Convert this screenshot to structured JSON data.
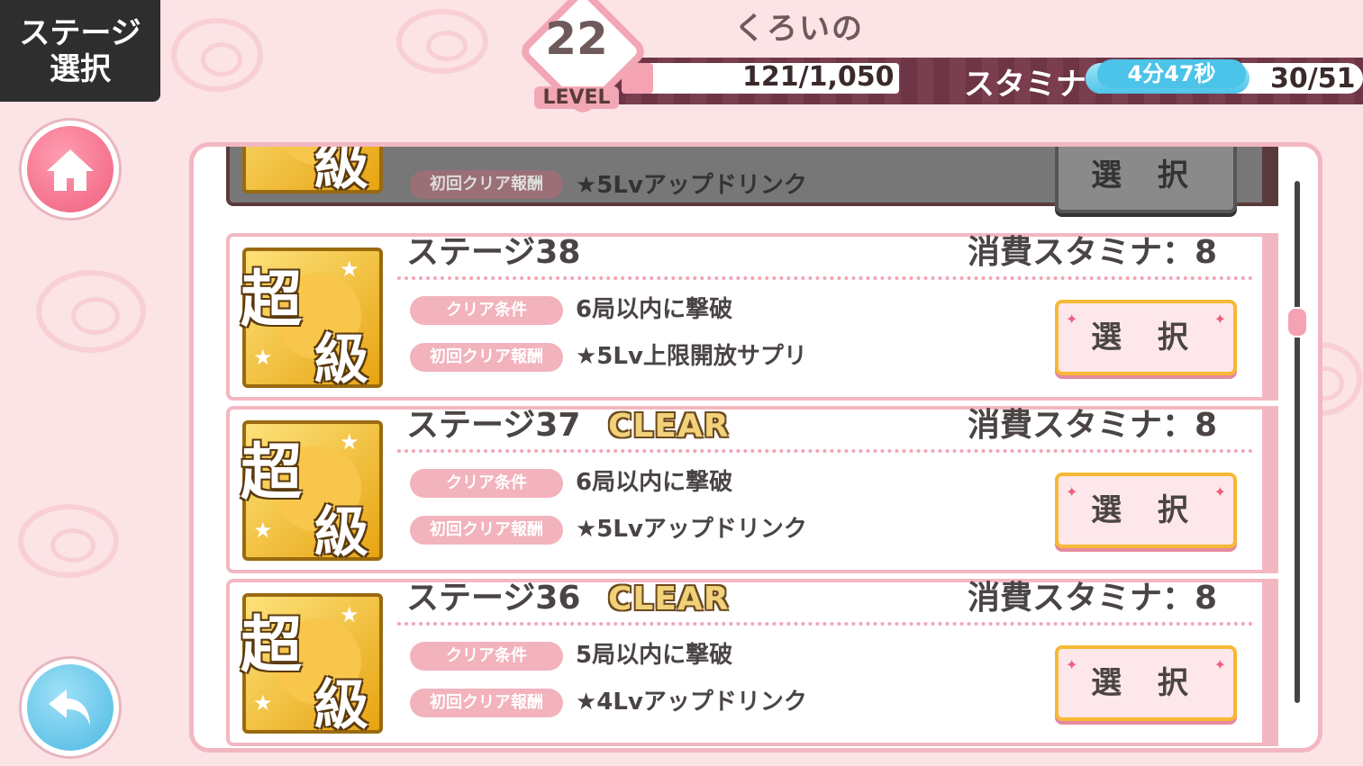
{
  "nav": {
    "stage_select_label_1": "ステージ",
    "stage_select_label_2": "選択"
  },
  "player": {
    "name": "くろいの",
    "level": "22",
    "level_label": "LEVEL",
    "exp_text": "121/1,050",
    "exp_fraction": 0.115
  },
  "stamina": {
    "label": "スタミナ",
    "timer": "4分47秒",
    "value": "30/51",
    "fraction": 0.59
  },
  "icons": {
    "home": "home-icon",
    "back": "back-arrow-icon"
  },
  "difficulty": {
    "kanji_1": "超",
    "kanji_2": "級"
  },
  "labels": {
    "clear_condition": "クリア条件",
    "first_clear_reward": "初回クリア報酬",
    "select": "選 択",
    "clear": "CLEAR"
  },
  "stages": [
    {
      "title": "",
      "cost": "",
      "condition": "",
      "reward": "★5Lvアップドリンク",
      "clear": "",
      "disabled": true
    },
    {
      "title": "ステージ38",
      "cost": "消費スタミナ：8",
      "condition": "6局以内に撃破",
      "reward": "★5Lv上限開放サプリ",
      "clear": "",
      "disabled": false
    },
    {
      "title": "ステージ37",
      "cost": "消費スタミナ：8",
      "condition": "6局以内に撃破",
      "reward": "★5Lvアップドリンク",
      "clear": "CLEAR",
      "disabled": false
    },
    {
      "title": "ステージ36",
      "cost": "消費スタミナ：8",
      "condition": "5局以内に撃破",
      "reward": "★4Lvアップドリンク",
      "clear": "CLEAR",
      "disabled": false
    }
  ],
  "colors": {
    "accent_pink": "#f3b7c2",
    "header_dark": "#6d3545",
    "stamina_blue": "#4cc3e8",
    "gold": "#f7b833"
  }
}
